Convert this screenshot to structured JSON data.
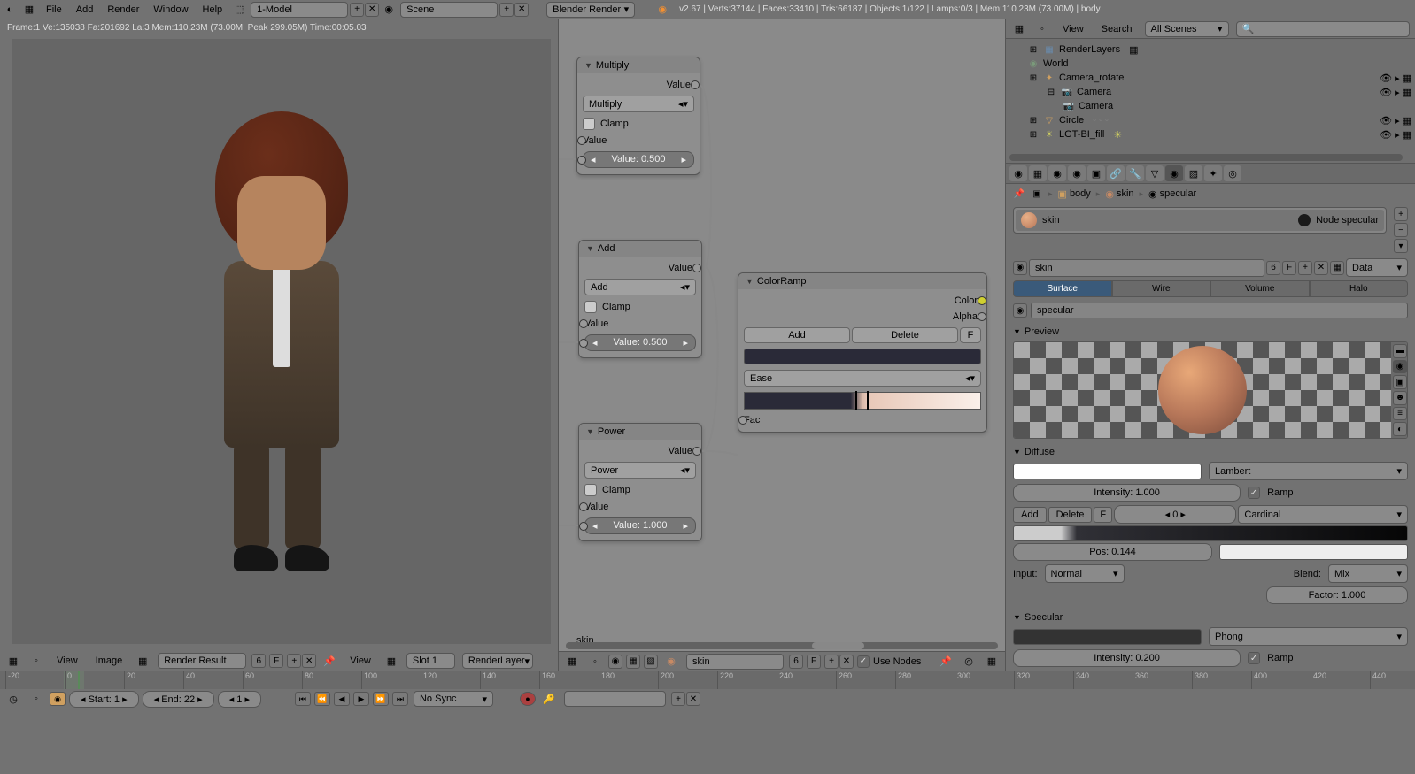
{
  "top_menu": {
    "items": [
      "File",
      "Add",
      "Render",
      "Window",
      "Help"
    ],
    "layout": "1-Model",
    "scene": "Scene",
    "engine": "Blender Render",
    "stats": "v2.67 | Verts:37144 | Faces:33410 | Tris:66187 | Objects:1/122 | Lamps:0/3 | Mem:110.23M (73.00M) | body"
  },
  "viewport": {
    "info": "Frame:1 Ve:135038 Fa:201692 La:3 Mem:110.23M (73.00M, Peak 299.05M) Time:00:05.03",
    "footer": {
      "view": "View",
      "image": "Image",
      "render_result": "Render Result",
      "slot": "Slot 1",
      "layer": "RenderLayer",
      "count": "6",
      "f": "F"
    }
  },
  "nodes": {
    "multiply": {
      "title": "Multiply",
      "out": "Value",
      "op": "Multiply",
      "clamp": "Clamp",
      "in1": "Value",
      "val": "Value: 0.500"
    },
    "add": {
      "title": "Add",
      "out": "Value",
      "op": "Add",
      "clamp": "Clamp",
      "in1": "Value",
      "val": "Value: 0.500"
    },
    "power": {
      "title": "Power",
      "out": "Value",
      "op": "Power",
      "clamp": "Clamp",
      "in1": "Value",
      "val": "Value: 1.000"
    },
    "colorramp": {
      "title": "ColorRamp",
      "out_color": "Color",
      "out_alpha": "Alpha",
      "add": "Add",
      "delete": "Delete",
      "f": "F",
      "interp": "Ease",
      "fac": "Fac"
    },
    "label": "skin",
    "footer": {
      "view": "View",
      "tree": "skin",
      "count": "6",
      "f": "F",
      "use_nodes": "Use Nodes"
    }
  },
  "outliner": {
    "header": {
      "view": "View",
      "search": "Search",
      "mode": "All Scenes"
    },
    "items": [
      {
        "name": "RenderLayers",
        "indent": 1,
        "icon": "scene"
      },
      {
        "name": "World",
        "indent": 1,
        "icon": "world"
      },
      {
        "name": "Camera_rotate",
        "indent": 1,
        "icon": "empty",
        "toggles": true
      },
      {
        "name": "Camera",
        "indent": 2,
        "icon": "camera",
        "toggles": true
      },
      {
        "name": "Camera",
        "indent": 3,
        "icon": "camera-data"
      },
      {
        "name": "Circle",
        "indent": 1,
        "icon": "mesh",
        "toggles": true
      },
      {
        "name": "LGT-BI_fill",
        "indent": 1,
        "icon": "lamp",
        "toggles": true
      }
    ]
  },
  "properties": {
    "breadcrumb": [
      "body",
      "skin",
      "specular"
    ],
    "materials": [
      {
        "name": "skin",
        "color": "#c88a64"
      },
      {
        "name": "Node specular",
        "color": "#1a1a1a"
      }
    ],
    "mat_name": "skin",
    "mat_users": "6",
    "mat_f": "F",
    "link": "Data",
    "shading_tabs": [
      "Surface",
      "Wire",
      "Volume",
      "Halo"
    ],
    "node_tree": "specular",
    "preview_label": "Preview",
    "diffuse": {
      "label": "Diffuse",
      "model": "Lambert",
      "intensity": "Intensity: 1.000",
      "ramp": "Ramp",
      "add": "Add",
      "delete": "Delete",
      "f": "F",
      "pos_val": "0",
      "blend": "Cardinal",
      "pos": "Pos: 0.144",
      "input_label": "Input:",
      "input": "Normal",
      "blend_label": "Blend:",
      "blend_mode": "Mix",
      "factor": "Factor: 1.000"
    },
    "specular": {
      "label": "Specular",
      "model": "Phong",
      "intensity": "Intensity: 0.200",
      "ramp": "Ramp"
    }
  },
  "timeline": {
    "ticks": [
      "-20",
      "0",
      "20",
      "40",
      "60",
      "80",
      "100",
      "120",
      "140",
      "160",
      "180",
      "200",
      "220",
      "240",
      "260",
      "280",
      "300",
      "320",
      "340",
      "360",
      "380",
      "400",
      "420",
      "440"
    ],
    "start": "Start: 1",
    "end": "End: 22",
    "current": "1",
    "sync": "No Sync"
  }
}
